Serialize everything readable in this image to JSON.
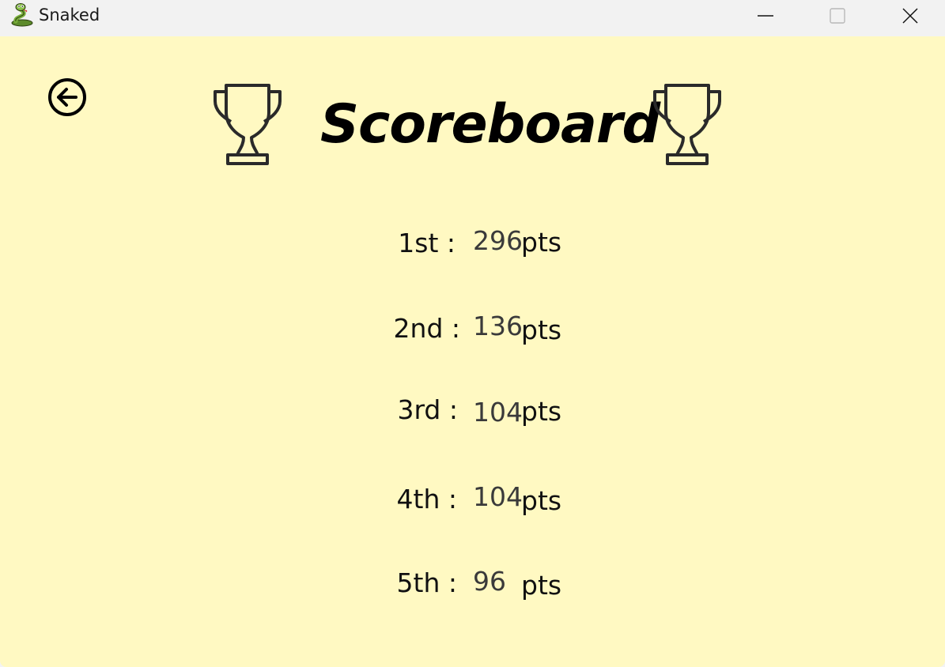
{
  "window": {
    "title": "Snaked",
    "app_icon": "snake-icon",
    "controls": [
      "minimize-icon",
      "maximize-icon",
      "close-icon"
    ]
  },
  "screen": {
    "heading": "Scoreboard",
    "back_icon": "arrow-left-circle-icon",
    "decor_icon": "trophy-icon",
    "background_color": "#fff9c2"
  },
  "scores": [
    {
      "rank": "1st :",
      "score": "296",
      "unit": "pts"
    },
    {
      "rank": "2nd :",
      "score": "136",
      "unit": "pts"
    },
    {
      "rank": "3rd :",
      "score": "104",
      "unit": "pts"
    },
    {
      "rank": "4th :",
      "score": "104",
      "unit": "pts"
    },
    {
      "rank": "5th :",
      "score": "96",
      "unit": "pts"
    }
  ]
}
